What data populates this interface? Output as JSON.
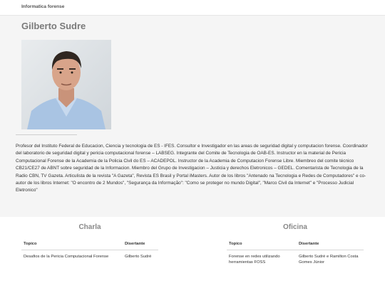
{
  "header": {
    "brand": "Informatica forense"
  },
  "speaker": {
    "name": "Gilberto Sudre",
    "bio": "Profesor del Instituto Federal de Educacion, Ciencia y tecnologia de ES - IFES. Consultor e Investigador en las areas de seguridad digital y computacion forense. Coordinador del laboratorio de seguridad digital y pericia computacional forense – LABSEG. Integrante del Comite de Tecnologia de OAB-ES. Instructor en la material de Pericia Computacional Forense de la Academia de la Policia Civil do ES – ACADEPOL. Instructor de la Academia de Computacion Forense Libre. Miembreo del comite técnico CB21/CE27 de ABNT sobre seguridad de la Informacion. Miembro del Grupo de Investigacion – Justicia y derechos Eletronicos – GEDEL. Comentarista de Tecnologia de la Radio CBN, TV Gazeta. Articulista de la revista \"A Gazeta\", Revista ES Brasil y Portal iMasters. Autor de los libros \"Antenado na Tecnologia e Redes de Computadores\" e co-autor de los libros Internet: \"O encontro de 2 Mundos\", \"Segurança da Informação\": \"Como se proteger no mundo Digital\", \"Marco Civil da Internet\" e \"Processo Judicial Eletronico\""
  },
  "charla": {
    "title": "Charla",
    "columns": [
      "Topico",
      "Disertante"
    ],
    "rows": [
      {
        "topico": "Desafios de la Pericia Computacional Forense",
        "disertante": "Gilberto Sudré"
      }
    ]
  },
  "oficina": {
    "title": "Oficina",
    "columns": [
      "Topico",
      "Disertante"
    ],
    "rows": [
      {
        "topico": "Forense en redes utilizando herramientas FOSS",
        "disertante": "Gilberto Sudré e Ramilton Costa Gomes Júnior"
      }
    ]
  }
}
